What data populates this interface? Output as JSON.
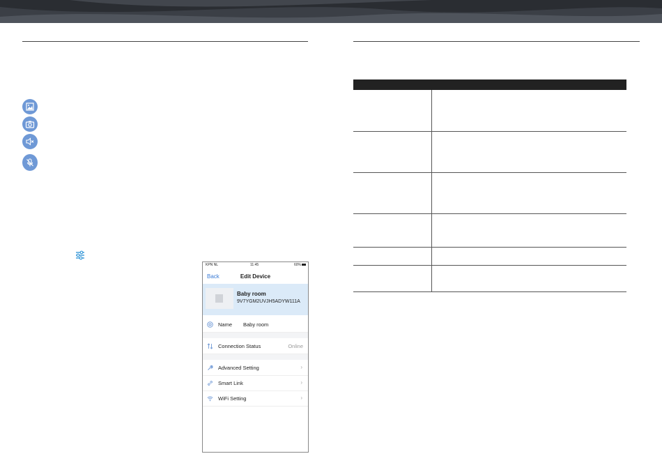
{
  "theme": {
    "header_dark": "#2a2d32",
    "header_mid": "#4a4e55",
    "accent_blue": "#6f99d6",
    "link_blue": "#3a7bd5",
    "card_blue": "#dbeaf8"
  },
  "left_icons": [
    "gallery-icon",
    "camera-icon",
    "speaker-mute-icon",
    "mic-mute-icon"
  ],
  "settings_icon": "sliders-icon",
  "phone": {
    "status": {
      "carrier": "KPN NL",
      "time": "11:45",
      "battery": "60%"
    },
    "nav": {
      "back": "Back",
      "title": "Edit Device"
    },
    "device": {
      "name": "Baby room",
      "id": "9V7YGM2UVJH5ADYW111A"
    },
    "name_row": {
      "label": "Name",
      "value": "Baby room"
    },
    "connection_row": {
      "label": "Connection Status",
      "value": "Online"
    },
    "menu": [
      {
        "label": "Advanced Setting",
        "icon": "wrench-icon"
      },
      {
        "label": "Smart Link",
        "icon": "link-icon"
      },
      {
        "label": "WiFi Setting",
        "icon": "wifi-icon"
      }
    ]
  },
  "table": {
    "columns": 2,
    "row_count": 6
  }
}
